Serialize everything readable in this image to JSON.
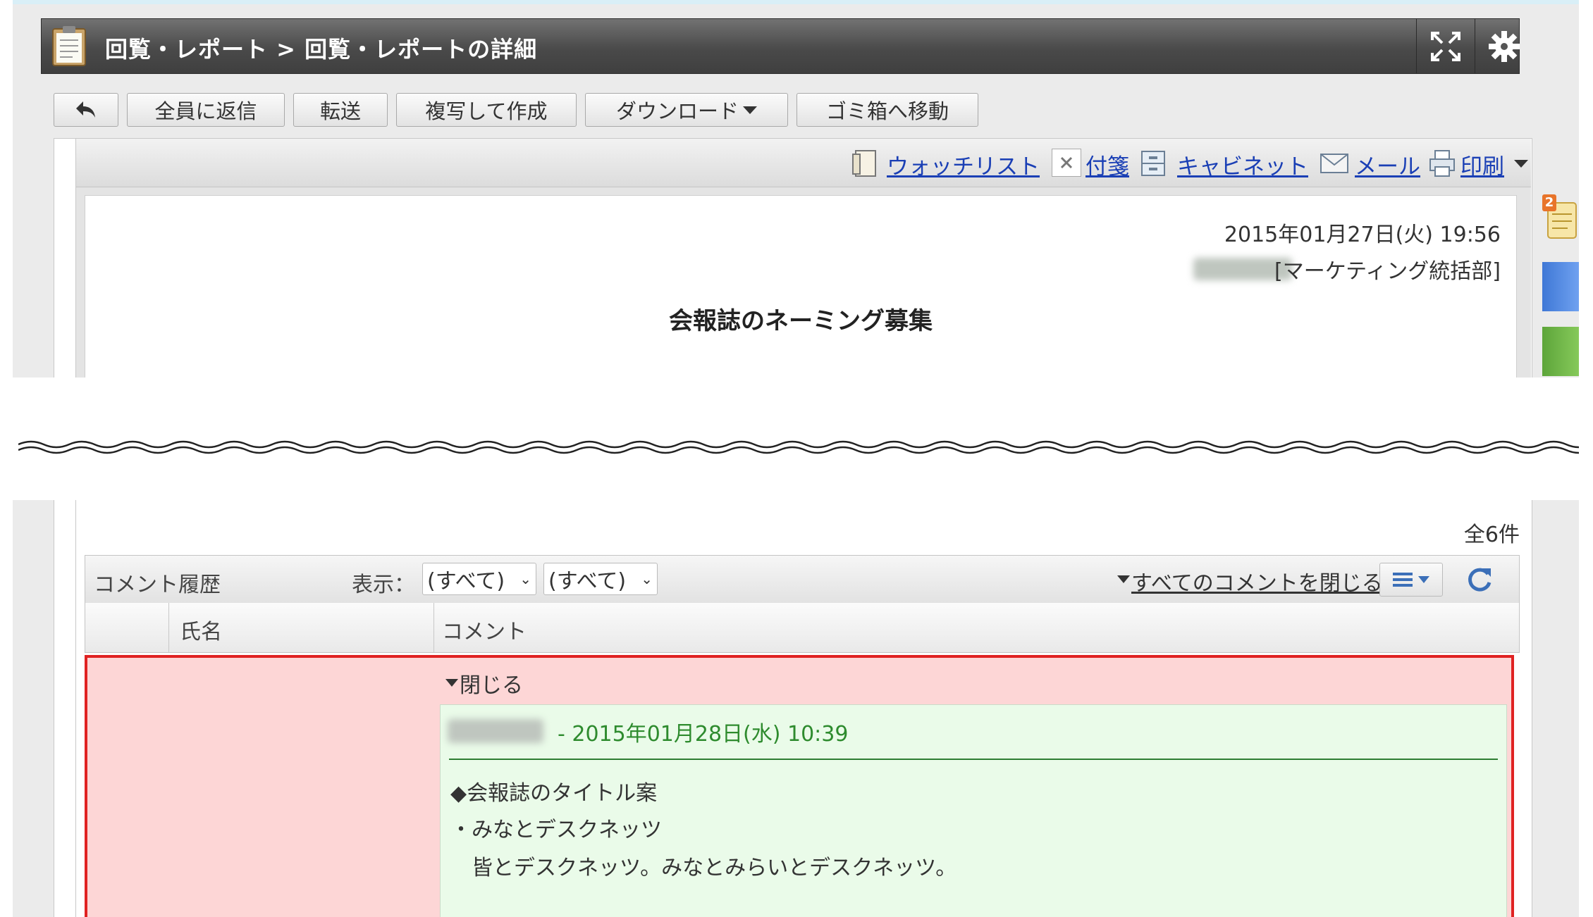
{
  "header": {
    "title": "回覧・レポート > 回覧・レポートの詳細"
  },
  "toolbar": {
    "back_label": "",
    "reply_all": "全員に返信",
    "forward": "転送",
    "copy_create": "複写して作成",
    "download": "ダウンロード",
    "trash": "ゴミ箱へ移動"
  },
  "actions": {
    "watchlist": "ウォッチリスト",
    "sticky": "付箋",
    "cabinet": "キャビネット",
    "mail": "メール",
    "print": "印刷"
  },
  "side": {
    "badge_count": "2"
  },
  "report": {
    "datetime": "2015年01月27日(火) 19:56",
    "department": "[マーケティング統括部]",
    "title": "会報誌のネーミング募集"
  },
  "comments": {
    "total": "全6件",
    "history_label": "コメント履歴",
    "display_label": "表示：",
    "filter1": "(すべて)",
    "filter2": "(すべて)",
    "close_all": "すべてのコメントを閉じる",
    "col_name": "氏名",
    "col_comment": "コメント",
    "item": {
      "toggle": "閉じる",
      "date": "- 2015年01月28日(水) 10:39",
      "lines": [
        "◆会報誌のタイトル案",
        "・みなとデスクネッツ",
        "皆とデスクネッツ。みなとみらいとデスクネッツ。"
      ]
    }
  }
}
